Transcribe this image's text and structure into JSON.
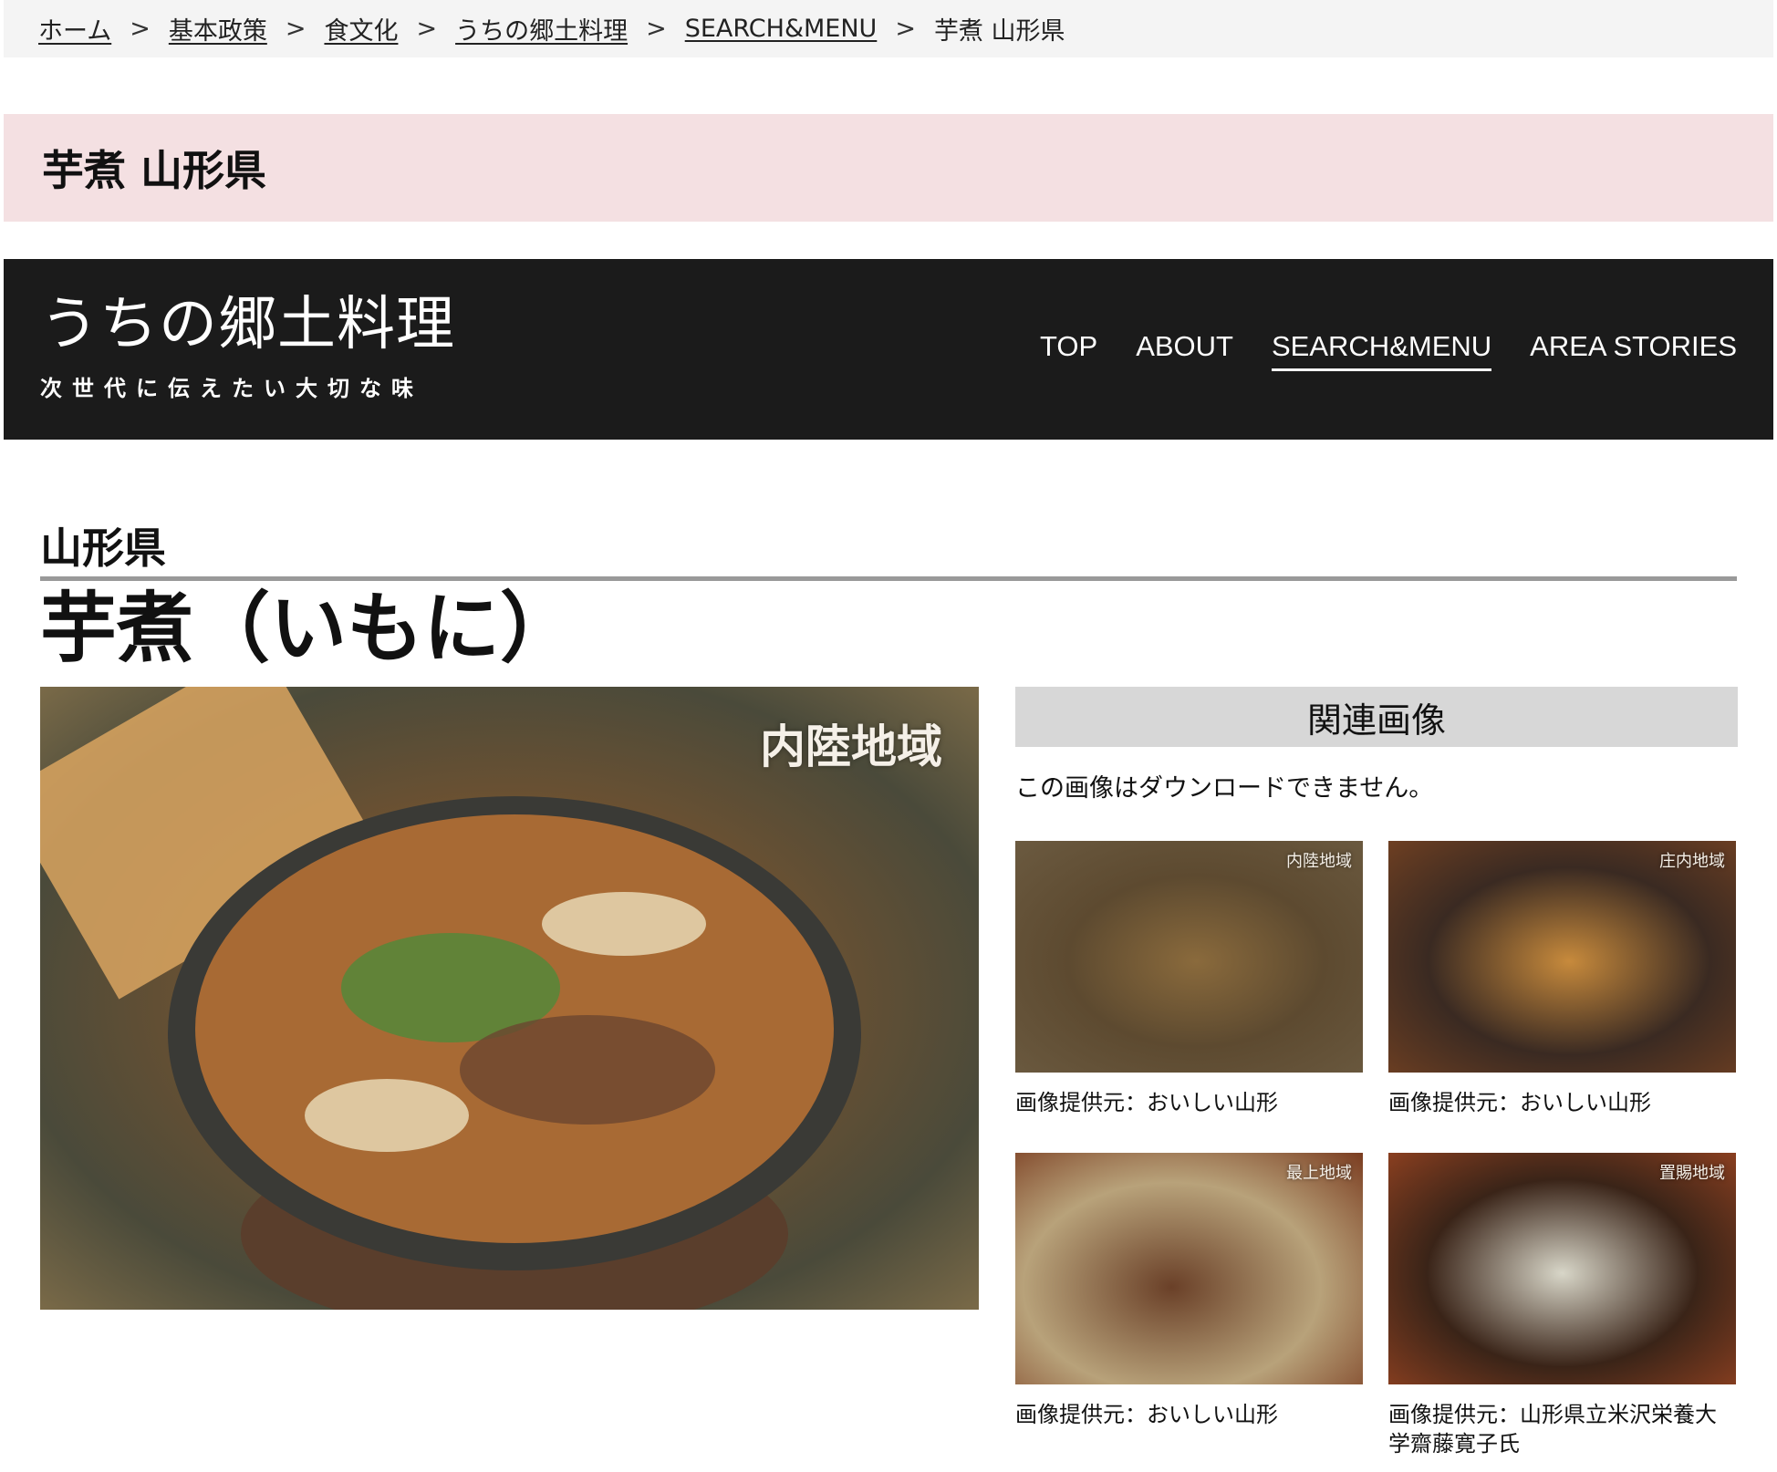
{
  "breadcrumb": {
    "items": [
      "ホーム",
      "基本政策",
      "食文化",
      "うちの郷土料理",
      "SEARCH&MENU"
    ],
    "separator": ">",
    "current": "芋煮 山形県"
  },
  "page_title": "芋煮 山形県",
  "header": {
    "logo_main": "うちの郷土料理",
    "logo_sub": "次世代に伝えたい大切な味",
    "nav": [
      "TOP",
      "ABOUT",
      "SEARCH&MENU",
      "AREA STORIES"
    ],
    "active_nav": "SEARCH&MENU"
  },
  "content": {
    "prefecture": "山形県",
    "dish_name": "芋煮（いもに）",
    "main_photo_region": "内陸地域"
  },
  "related": {
    "heading": "関連画像",
    "notice": "この画像はダウンロードできません。",
    "images": [
      {
        "region": "内陸地域",
        "caption": "画像提供元：おいしい山形"
      },
      {
        "region": "庄内地域",
        "caption": "画像提供元：おいしい山形"
      },
      {
        "region": "最上地域",
        "caption": "画像提供元：おいしい山形"
      },
      {
        "region": "置賜地域",
        "caption": "画像提供元：山形県立米沢栄養大学齋藤寛子氏"
      }
    ]
  }
}
